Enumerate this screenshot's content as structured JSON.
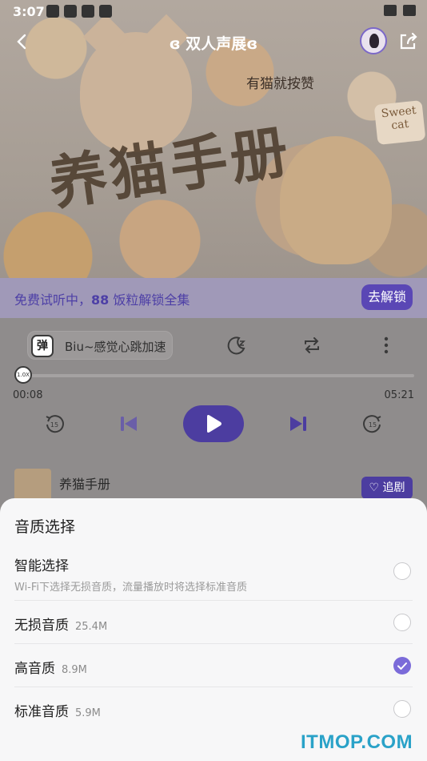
{
  "status_bar": {
    "time": "3:07"
  },
  "header": {
    "title": "ɞ 双人声展ɞ"
  },
  "cover": {
    "art_title": "养猫手册",
    "caption": "有猫就按赞",
    "badge": "Sweet cat"
  },
  "trial": {
    "prefix": "免费试听中，",
    "count": "88",
    "suffix": " 饭粒解锁全集",
    "unlock_label": "去解锁"
  },
  "danmu": {
    "tag": "弹",
    "text": "Biu~感觉心跳加速"
  },
  "progress": {
    "current": "00:08",
    "total": "05:21",
    "fraction": 0.025,
    "knob_label": "1.0X"
  },
  "episode": {
    "title": "养猫手册",
    "follow_label": "♡ 追剧"
  },
  "quality_sheet": {
    "title": "音质选择",
    "options": [
      {
        "label": "智能选择",
        "size": "",
        "desc": "Wi-Fi下选择无损音质，流量播放时将选择标准音质",
        "selected": false
      },
      {
        "label": "无损音质",
        "size": "25.4M",
        "desc": "",
        "selected": false
      },
      {
        "label": "高音质",
        "size": "8.9M",
        "desc": "",
        "selected": true
      },
      {
        "label": "标准音质",
        "size": "5.9M",
        "desc": "",
        "selected": false
      }
    ]
  },
  "watermark": "ITMOP.COM",
  "colors": {
    "accent": "#7b6bd9",
    "watermark": "#2aa2c8"
  }
}
